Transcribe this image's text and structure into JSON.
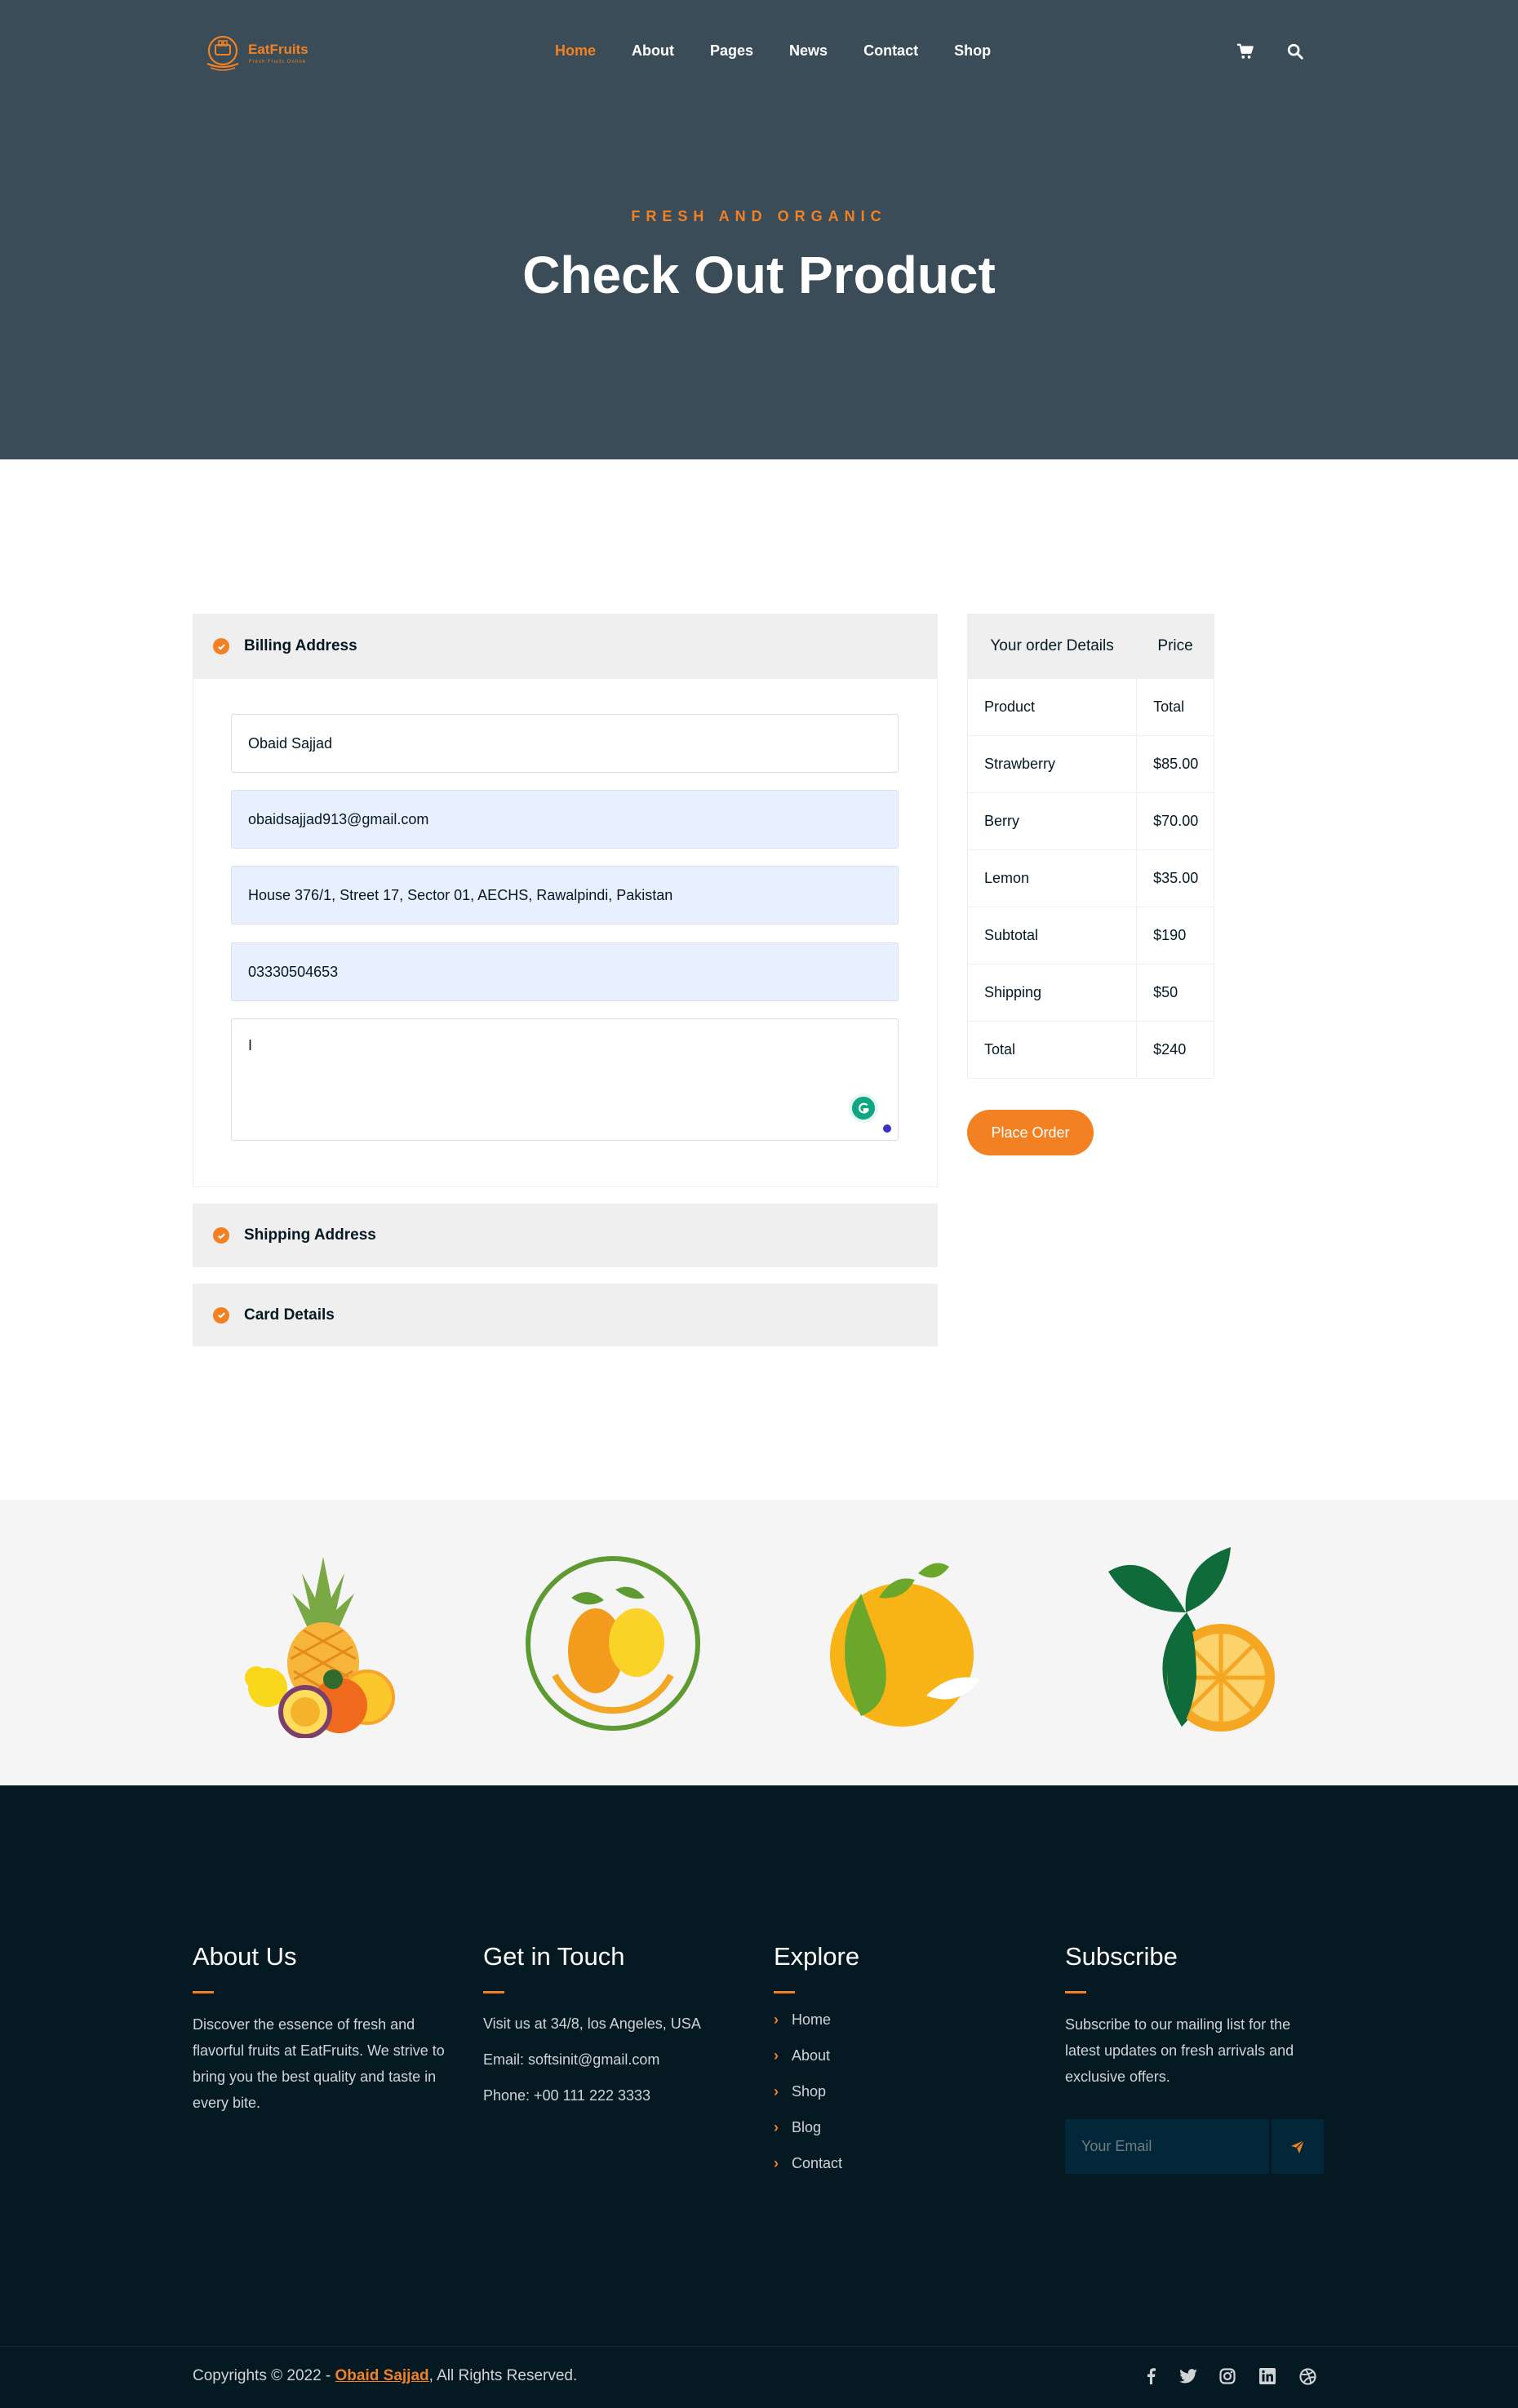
{
  "brand": {
    "name": "EatFruits",
    "tagline": "Fresh Fruits Online",
    "accent_color": "#f28123"
  },
  "nav": {
    "items": [
      {
        "label": "Home",
        "active": true
      },
      {
        "label": "About"
      },
      {
        "label": "Pages"
      },
      {
        "label": "News"
      },
      {
        "label": "Contact"
      },
      {
        "label": "Shop"
      }
    ],
    "icons": [
      "cart-icon",
      "search-icon"
    ]
  },
  "hero": {
    "subtitle": "FRESH AND ORGANIC",
    "title": "Check Out Product"
  },
  "checkout": {
    "sections": [
      {
        "title": "Billing Address",
        "expanded": true
      },
      {
        "title": "Shipping Address",
        "expanded": false
      },
      {
        "title": "Card Details",
        "expanded": false
      }
    ],
    "billing": {
      "name": "Obaid Sajjad",
      "email": "obaidsajjad913@gmail.com",
      "address": "House 376/1, Street 17, Sector 01, AECHS, Rawalpindi, Pakistan",
      "phone": "03330504653",
      "notes": "I"
    }
  },
  "order": {
    "headers": [
      "Your order Details",
      "Price"
    ],
    "rows": [
      [
        "Product",
        "Total"
      ],
      [
        "Strawberry",
        "$85.00"
      ],
      [
        "Berry",
        "$70.00"
      ],
      [
        "Lemon",
        "$35.00"
      ],
      [
        "Subtotal",
        "$190"
      ],
      [
        "Shipping",
        "$50"
      ],
      [
        "Total",
        "$240"
      ]
    ],
    "button": "Place Order"
  },
  "partner_logos": [
    "pineapple-fruit-logo",
    "mango-circle-logo",
    "mango-leaf-logo",
    "orange-leaf-logo"
  ],
  "footer": {
    "about": {
      "title": "About Us",
      "text": "Discover the essence of fresh and flavorful fruits at EatFruits. We strive to bring you the best quality and taste in every bite."
    },
    "contact": {
      "title": "Get in Touch",
      "lines": [
        "Visit us at 34/8, los Angeles, USA",
        "Email: softsinit@gmail.com",
        "Phone: +00 111 222 3333"
      ]
    },
    "explore": {
      "title": "Explore",
      "links": [
        "Home",
        "About",
        "Shop",
        "Blog",
        "Contact"
      ]
    },
    "subscribe": {
      "title": "Subscribe",
      "text": "Subscribe to our mailing list for the latest updates on fresh arrivals and exclusive offers.",
      "placeholder": "Your Email"
    },
    "copyright_prefix": "Copyrights © 2022 - ",
    "copyright_owner": "Obaid Sajjad",
    "copyright_suffix": ", All Rights Reserved.",
    "socials": [
      "facebook-icon",
      "twitter-icon",
      "instagram-icon",
      "linkedin-icon",
      "dribbble-icon"
    ]
  }
}
